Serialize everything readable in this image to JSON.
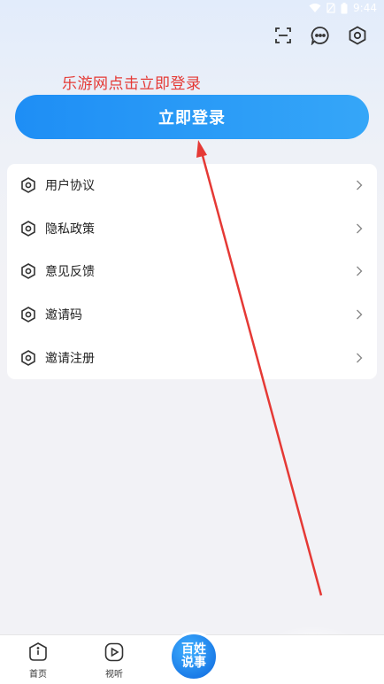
{
  "status_bar": {
    "time": "9:44"
  },
  "annotation": {
    "text": "乐游网点击立即登录"
  },
  "login": {
    "label": "立即登录"
  },
  "menu": {
    "items": [
      {
        "label": "用户协议",
        "icon": "hexagon-settings-icon"
      },
      {
        "label": "隐私政策",
        "icon": "hexagon-settings-icon"
      },
      {
        "label": "意见反馈",
        "icon": "hexagon-settings-icon"
      },
      {
        "label": "邀请码",
        "icon": "hexagon-settings-icon"
      },
      {
        "label": "邀请注册",
        "icon": "hexagon-settings-icon"
      }
    ]
  },
  "tabs": {
    "home": {
      "label": "首页"
    },
    "listen": {
      "label": "视听"
    },
    "center": {
      "line1": "百姓",
      "line2": "说事"
    }
  },
  "colors": {
    "accent": "#1e8ef5",
    "annotation": "#e53935",
    "card_bg": "#ffffff",
    "page_bg": "#f2f2f6"
  }
}
